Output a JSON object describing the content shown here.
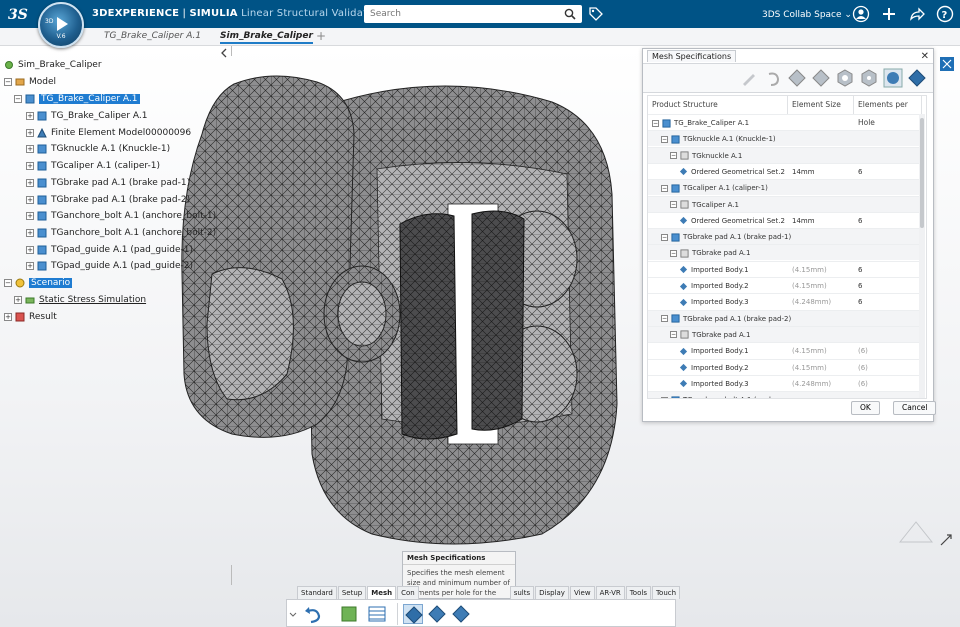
{
  "app": {
    "brand": "3DEXPERIENCE",
    "separator": " | ",
    "suite": "SIMULIA",
    "app_name": "Linear Structural Validation",
    "compass_label": "3D",
    "compass_version": "V.6",
    "search_placeholder": "Search",
    "collab_space": "3DS Collab Space",
    "chevron": "⌄"
  },
  "tabs": [
    {
      "label": "TG_Brake_Caliper A.1"
    },
    {
      "label": "Sim_Brake_Caliper"
    }
  ],
  "tree": {
    "root": "Sim_Brake_Caliper",
    "model": "Model",
    "product": "TG_Brake_Caliper A.1",
    "children": [
      "TG_Brake_Caliper A.1",
      "Finite Element Model00000096",
      "TGknuckle A.1 (Knuckle-1)",
      "TGcaliper A.1 (caliper-1)",
      "TGbrake pad A.1 (brake pad-1)",
      "TGbrake pad A.1 (brake pad-2)",
      "TGanchore_bolt A.1 (anchore_bolt-1)",
      "TGanchore_bolt A.1 (anchore_bolt-2)",
      "TGpad_guide A.1 (pad_guide-1)",
      "TGpad_guide A.1 (pad_guide-2)"
    ],
    "scenario": "Scenario",
    "simulation": "Static Stress Simulation",
    "result": "Result"
  },
  "dialog": {
    "title": "Mesh Specifications",
    "columns": [
      "Product Structure",
      "Element Size",
      "Elements per Hole"
    ],
    "rows": [
      {
        "label": "TG_Brake_Caliper A.1",
        "size": "",
        "holes": "",
        "level": 0,
        "kind": "product"
      },
      {
        "label": "TGknuckle A.1 (Knuckle-1)",
        "size": "",
        "holes": "",
        "level": 1,
        "kind": "part"
      },
      {
        "label": "TGknuckle A.1",
        "size": "",
        "holes": "",
        "level": 2,
        "kind": "rep"
      },
      {
        "label": "Ordered Geometrical Set.2",
        "size": "14mm",
        "holes": "6",
        "level": 3,
        "kind": "body",
        "dim": false
      },
      {
        "label": "TGcaliper A.1 (caliper-1)",
        "size": "",
        "holes": "",
        "level": 1,
        "kind": "part"
      },
      {
        "label": "TGcaliper A.1",
        "size": "",
        "holes": "",
        "level": 2,
        "kind": "rep"
      },
      {
        "label": "Ordered Geometrical Set.2",
        "size": "14mm",
        "holes": "6",
        "level": 3,
        "kind": "body",
        "dim": false
      },
      {
        "label": "TGbrake pad A.1 (brake pad-1)",
        "size": "",
        "holes": "",
        "level": 1,
        "kind": "part"
      },
      {
        "label": "TGbrake pad A.1",
        "size": "",
        "holes": "",
        "level": 2,
        "kind": "rep"
      },
      {
        "label": "Imported Body.1",
        "size": "(4.15mm)",
        "holes": "6",
        "level": 3,
        "kind": "body",
        "dim": true
      },
      {
        "label": "Imported Body.2",
        "size": "(4.15mm)",
        "holes": "6",
        "level": 3,
        "kind": "body",
        "dim": true
      },
      {
        "label": "Imported Body.3",
        "size": "(4.248mm)",
        "holes": "6",
        "level": 3,
        "kind": "body",
        "dim": true
      },
      {
        "label": "TGbrake pad A.1 (brake pad-2)",
        "size": "",
        "holes": "",
        "level": 1,
        "kind": "part"
      },
      {
        "label": "TGbrake pad A.1",
        "size": "",
        "holes": "",
        "level": 2,
        "kind": "rep"
      },
      {
        "label": "Imported Body.1",
        "size": "(4.15mm)",
        "holes": "(6)",
        "level": 3,
        "kind": "body",
        "dim": true
      },
      {
        "label": "Imported Body.2",
        "size": "(4.15mm)",
        "holes": "(6)",
        "level": 3,
        "kind": "body",
        "dim": true
      },
      {
        "label": "Imported Body.3",
        "size": "(4.248mm)",
        "holes": "(6)",
        "level": 3,
        "kind": "body",
        "dim": true
      },
      {
        "label": "TGanchore_bolt A.1 (anchore...",
        "size": "",
        "holes": "",
        "level": 1,
        "kind": "part"
      }
    ],
    "ok": "OK",
    "cancel": "Cancel"
  },
  "tooltip": {
    "title": "Mesh Specifications",
    "body": "Specifies the mesh element size and minimum number of elements per hole for the model."
  },
  "section_tabs": [
    "Standard",
    "Setup",
    "Mesh",
    "Con",
    "sults",
    "Display",
    "View",
    "AR-VR",
    "Tools",
    "Touch"
  ],
  "active_section": "Mesh",
  "colors": {
    "topbar": "#005386",
    "selection": "#1f7cd1",
    "mesh_fill": "#8b8b8d",
    "mesh_line": "#2a2a2a"
  }
}
